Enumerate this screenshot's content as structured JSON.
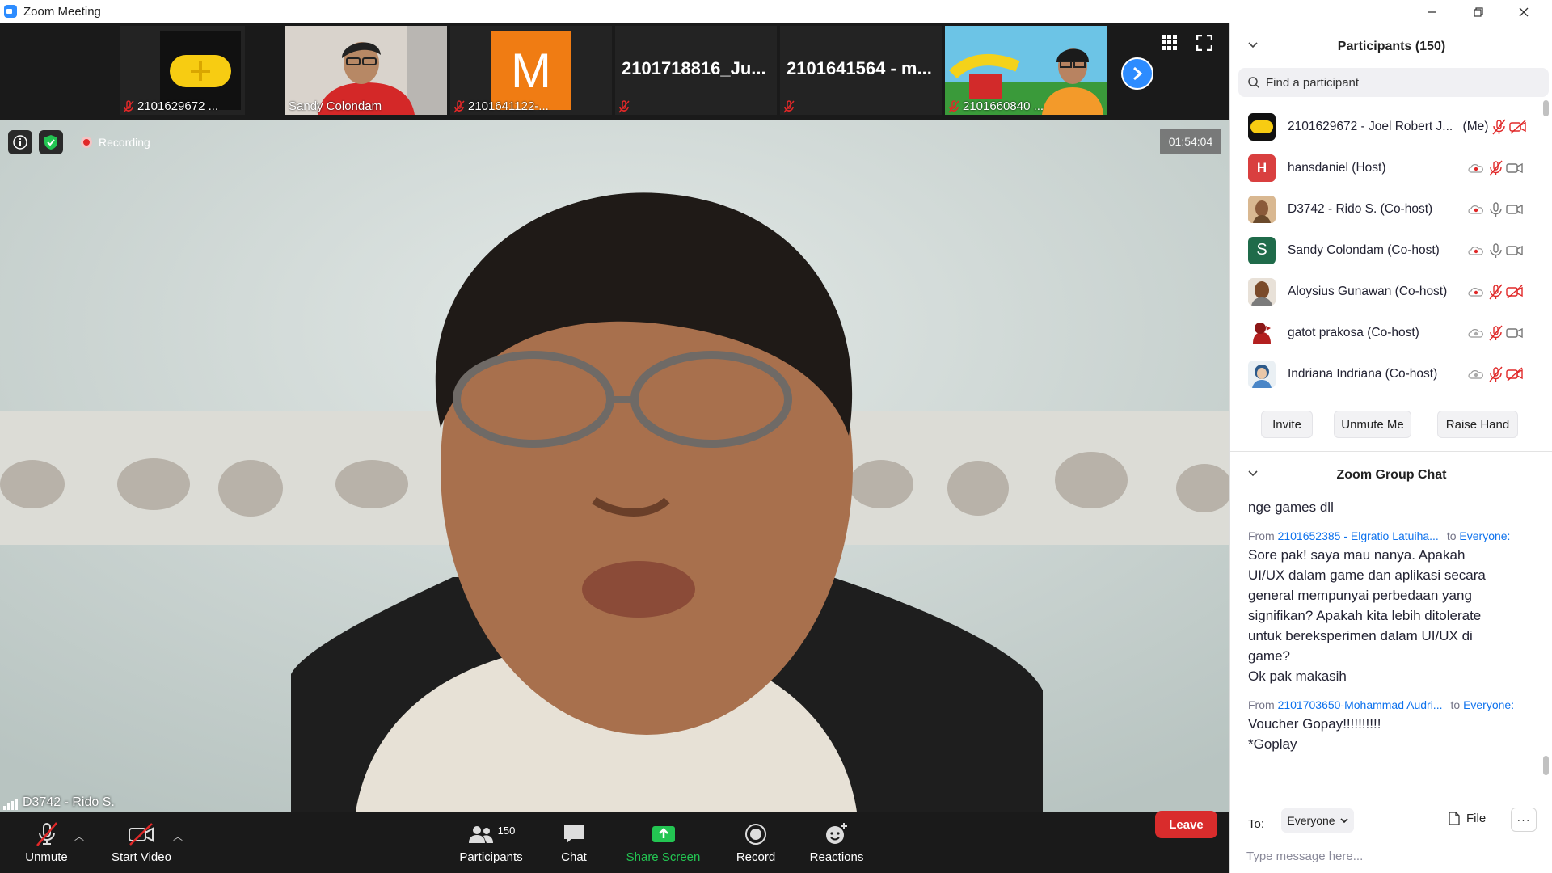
{
  "window": {
    "title": "Zoom Meeting"
  },
  "strip": {
    "thumbs": [
      {
        "name": "2101629672 ..."
      },
      {
        "name": "Sandy Colondam"
      },
      {
        "name": "2101641122-...",
        "initial": "M"
      },
      {
        "name": "2101718816_Ju..."
      },
      {
        "name": "2101641564 - m..."
      },
      {
        "name": "2101660840 ..."
      }
    ]
  },
  "main": {
    "recording_label": "Recording",
    "timer": "01:54:04",
    "speaker_name": "D3742 - Rido S."
  },
  "toolbar": {
    "unmute": "Unmute",
    "start_video": "Start Video",
    "participants": "Participants",
    "participants_count": "150",
    "chat": "Chat",
    "share_screen": "Share Screen",
    "record": "Record",
    "reactions": "Reactions",
    "leave": "Leave"
  },
  "participants_panel": {
    "title": "Participants (150)",
    "search_placeholder": "Find a participant",
    "items": [
      {
        "name": "2101629672 - Joel Robert J...",
        "suffix": "(Me)"
      },
      {
        "name": "hansdaniel (Host)",
        "initial": "H",
        "color": "#d93f3f"
      },
      {
        "name": "D3742 - Rido S. (Co-host)"
      },
      {
        "name": "Sandy Colondam (Co-host)",
        "initial": "S",
        "color": "#1f6b4a"
      },
      {
        "name": "Aloysius Gunawan (Co-host)"
      },
      {
        "name": "gatot prakosa (Co-host)"
      },
      {
        "name": "Indriana Indriana (Co-host)"
      }
    ],
    "invite": "Invite",
    "unmute_me": "Unmute Me",
    "raise_hand": "Raise Hand"
  },
  "chat_panel": {
    "title": "Zoom Group Chat",
    "partial_line": "nge games dll",
    "messages": [
      {
        "from_label": "From",
        "from": "2101652385 - Elgratio Latuiha...",
        "to_label": "to",
        "to": "Everyone:",
        "lines": [
          "Sore pak! saya mau nanya. Apakah",
          "UI/UX dalam game dan aplikasi secara",
          "general mempunyai perbedaan yang",
          "signifikan? Apakah kita lebih ditolerate",
          "untuk bereksperimen dalam UI/UX di",
          "game?",
          "Ok pak makasih"
        ]
      },
      {
        "from_label": "From",
        "from": "2101703650-Mohammad Audri...",
        "to_label": "to",
        "to": "Everyone:",
        "lines": [
          "Voucher Gopay!!!!!!!!!!",
          "*Goplay"
        ]
      }
    ],
    "to_label": "To:",
    "recipient": "Everyone",
    "file_label": "File",
    "message_placeholder": "Type message here..."
  },
  "colors": {
    "accent": "#2d8cff",
    "leave": "#d92c2c",
    "share": "#23c552",
    "mute_red": "#e02828"
  }
}
